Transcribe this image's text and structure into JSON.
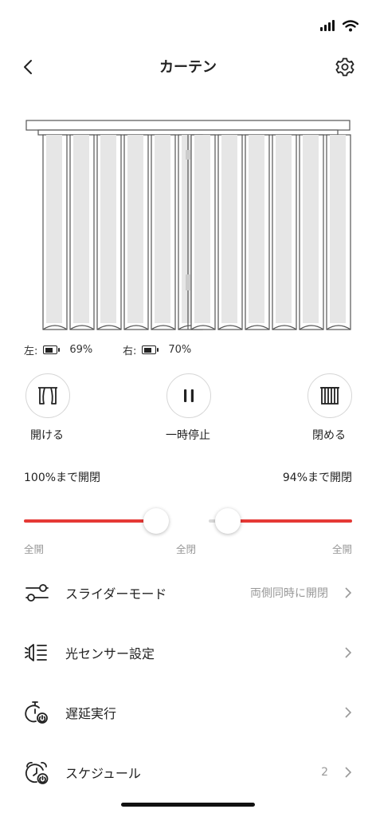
{
  "header": {
    "title": "カーテン"
  },
  "battery": {
    "left_label": "左:",
    "left_percent": "69%",
    "left_level": 0.69,
    "right_label": "右:",
    "right_percent": "70%",
    "right_level": 0.7
  },
  "controls": {
    "open_label": "開ける",
    "pause_label": "一時停止",
    "close_label": "閉める"
  },
  "sliders": {
    "left_text": "100%まで開閉",
    "right_text": "94%まで開閉",
    "left_value": 100,
    "right_value": 94,
    "label_open_left": "全開",
    "label_closed": "全閉",
    "label_open_right": "全開",
    "accent_color": "#e53935"
  },
  "settings": [
    {
      "label": "スライダーモード",
      "value": "両側同時に開閉",
      "icon": "sliders-icon"
    },
    {
      "label": "光センサー設定",
      "value": "",
      "icon": "light-sensor-icon"
    },
    {
      "label": "遅延実行",
      "value": "",
      "icon": "timer-icon"
    },
    {
      "label": "スケジュール",
      "value": "2",
      "icon": "alarm-clock-icon"
    }
  ]
}
